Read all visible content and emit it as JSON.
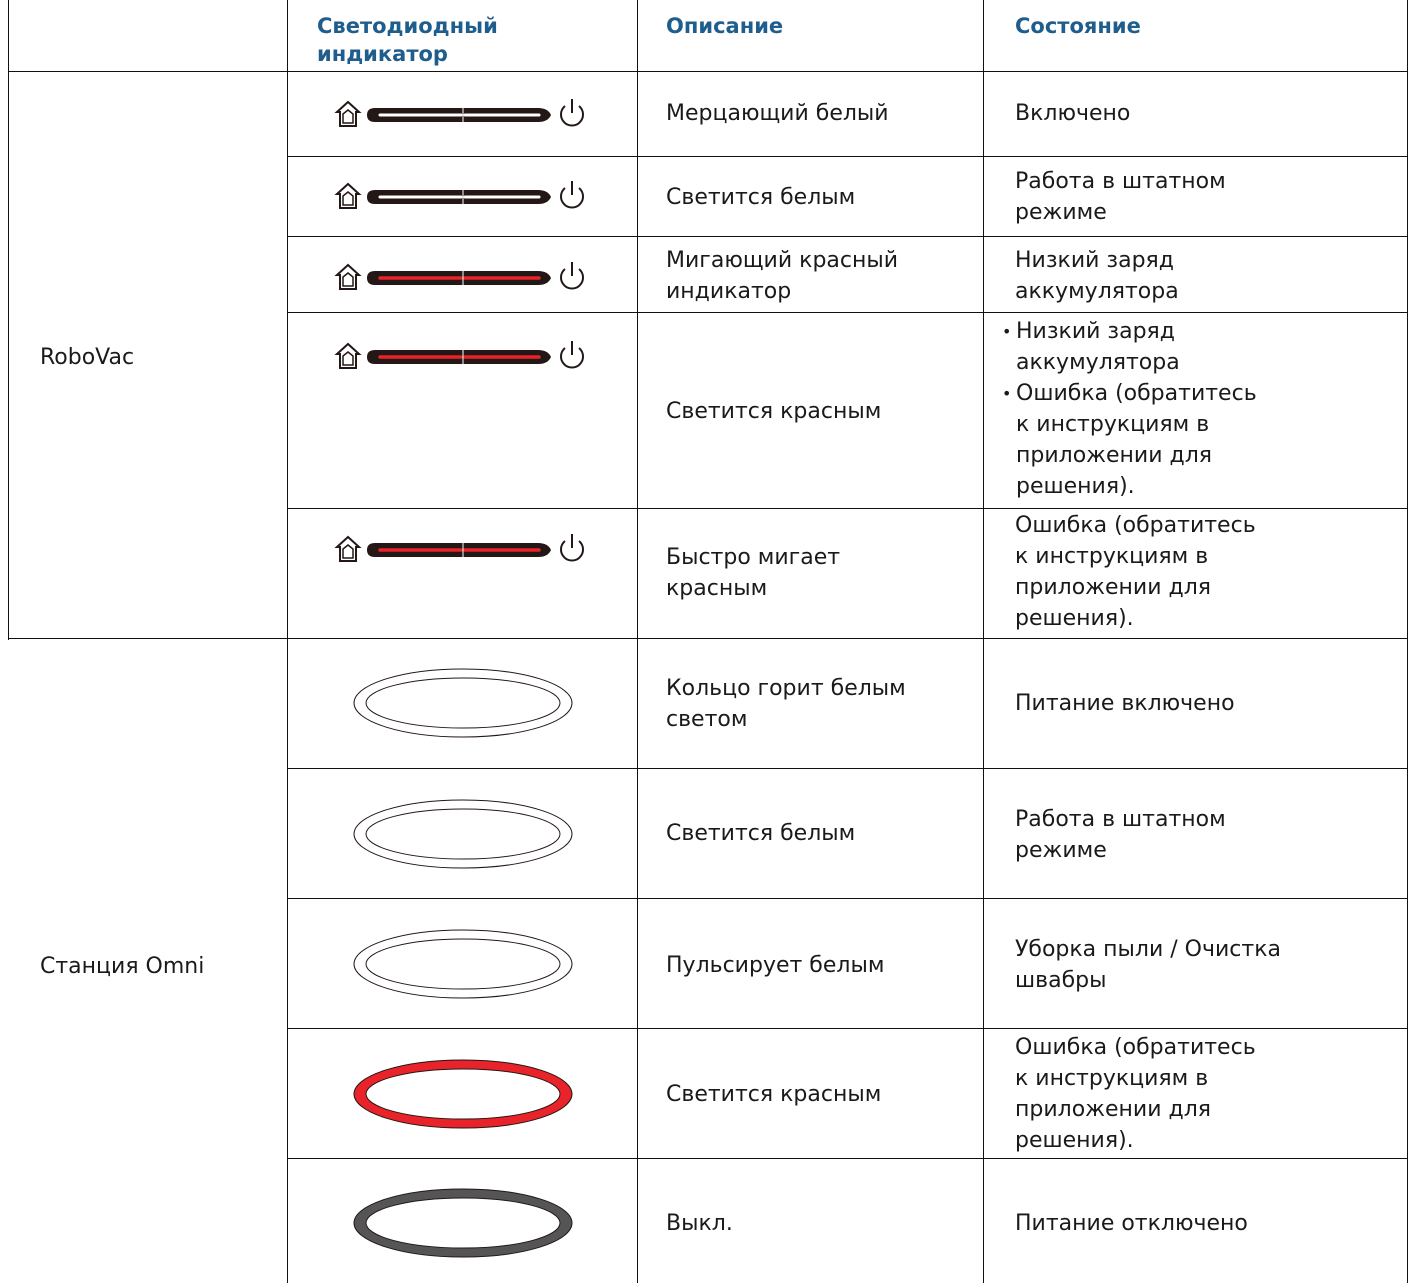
{
  "headers": {
    "col1": "",
    "col2_line1": "Светодиодный",
    "col2_line2": "индикатор",
    "col3": "Описание",
    "col4": "Состояние"
  },
  "groups": [
    {
      "name": "RoboVac"
    },
    {
      "name": "Станция Omni"
    }
  ],
  "robovac_rows": [
    {
      "light": "white",
      "description": [
        "Мерцающий белый"
      ],
      "status": [
        "Включено"
      ]
    },
    {
      "light": "white",
      "description": [
        "Светится белым"
      ],
      "status": [
        "Работа в штатном",
        "режиме"
      ]
    },
    {
      "light": "red",
      "description": [
        "Мигающий красный",
        "индикатор"
      ],
      "status": [
        "Низкий заряд",
        "аккумулятора"
      ]
    },
    {
      "light": "red",
      "description": [
        "Светится красным"
      ],
      "status_bullets": [
        [
          "Низкий заряд",
          "аккумулятора"
        ],
        [
          "Ошибка (обратитесь",
          "к инструкциям в",
          "приложении для",
          "решения)."
        ]
      ]
    },
    {
      "light": "red",
      "description": [
        "Быстро мигает",
        "красным"
      ],
      "status": [
        "Ошибка (обратитесь",
        "к инструкциям в",
        "приложении для",
        "решения)."
      ]
    }
  ],
  "omni_rows": [
    {
      "ring": "white",
      "description": [
        "Кольцо горит белым",
        "светом"
      ],
      "status": [
        "Питание включено"
      ]
    },
    {
      "ring": "white",
      "description": [
        "Светится белым"
      ],
      "status": [
        "Работа в штатном",
        "режиме"
      ]
    },
    {
      "ring": "white",
      "description": [
        "Пульсирует белым"
      ],
      "status": [
        "Уборка пыли / Очистка",
        "швабры"
      ]
    },
    {
      "ring": "red",
      "description": [
        "Светится красным"
      ],
      "status": [
        "Ошибка (обратитесь",
        "к инструкциям в",
        "приложении для",
        "решения)."
      ]
    },
    {
      "ring": "off",
      "description": [
        "Выкл."
      ],
      "status": [
        "Питание отключено"
      ]
    }
  ],
  "colors": {
    "header_text": "#1f5d8c",
    "led_red": "#e8232a",
    "led_white_bar": "#ffffff",
    "led_frame": "#231815",
    "ring_red": "#e8232a",
    "ring_off": "#555555"
  }
}
